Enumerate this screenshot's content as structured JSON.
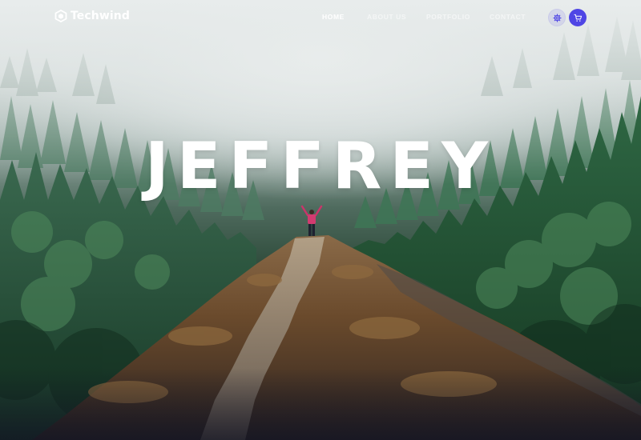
{
  "brand": {
    "name": "Techwind",
    "logo_icon": "hexagon-logo-icon"
  },
  "nav": {
    "items": [
      {
        "label": "HOME",
        "active": true
      },
      {
        "label": "ABOUT US",
        "active": false
      },
      {
        "label": "PORTFOLIO",
        "active": false
      },
      {
        "label": "CONTACT",
        "active": false
      }
    ],
    "settings_icon": "gear-icon",
    "cart_icon": "shopping-cart-icon"
  },
  "hero": {
    "title": "JEFFREY"
  },
  "colors": {
    "accent": "#4f46e5",
    "forest_dark": "#163a26",
    "fog": "#e9ecec",
    "mountain": "#6b4a30"
  }
}
